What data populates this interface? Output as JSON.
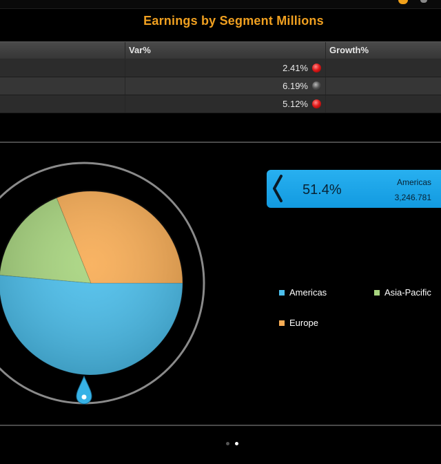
{
  "page": {
    "title": "Earnings by Segment Millions"
  },
  "table": {
    "headers": [
      "",
      "Var%",
      "Growth%"
    ],
    "rows": [
      {
        "label": "",
        "var": "2.41%",
        "status": "red",
        "growth": ""
      },
      {
        "label": "",
        "var": "6.19%",
        "status": "gray",
        "growth": ""
      },
      {
        "label": "",
        "var": "5.12%",
        "status": "red",
        "growth": ""
      }
    ]
  },
  "colors": {
    "americas": "#4cbfec",
    "asia_pacific": "#a8d57f",
    "europe": "#f8ad56",
    "accent": "#f0a020"
  },
  "chart_data": {
    "type": "pie",
    "title": "",
    "slices": [
      {
        "name": "Americas",
        "percent": 51.4,
        "value": 3246.781
      },
      {
        "name": "Asia-Pacific",
        "percent": 17.5
      },
      {
        "name": "Europe",
        "percent": 31.1
      }
    ],
    "legend": [
      "Americas",
      "Asia-Pacific",
      "Europe"
    ],
    "legend_position": "right"
  },
  "callout": {
    "percent": "51.4%",
    "segment": "Americas",
    "value": "3,246.781"
  },
  "pager": {
    "pages": 2,
    "active": 2
  }
}
